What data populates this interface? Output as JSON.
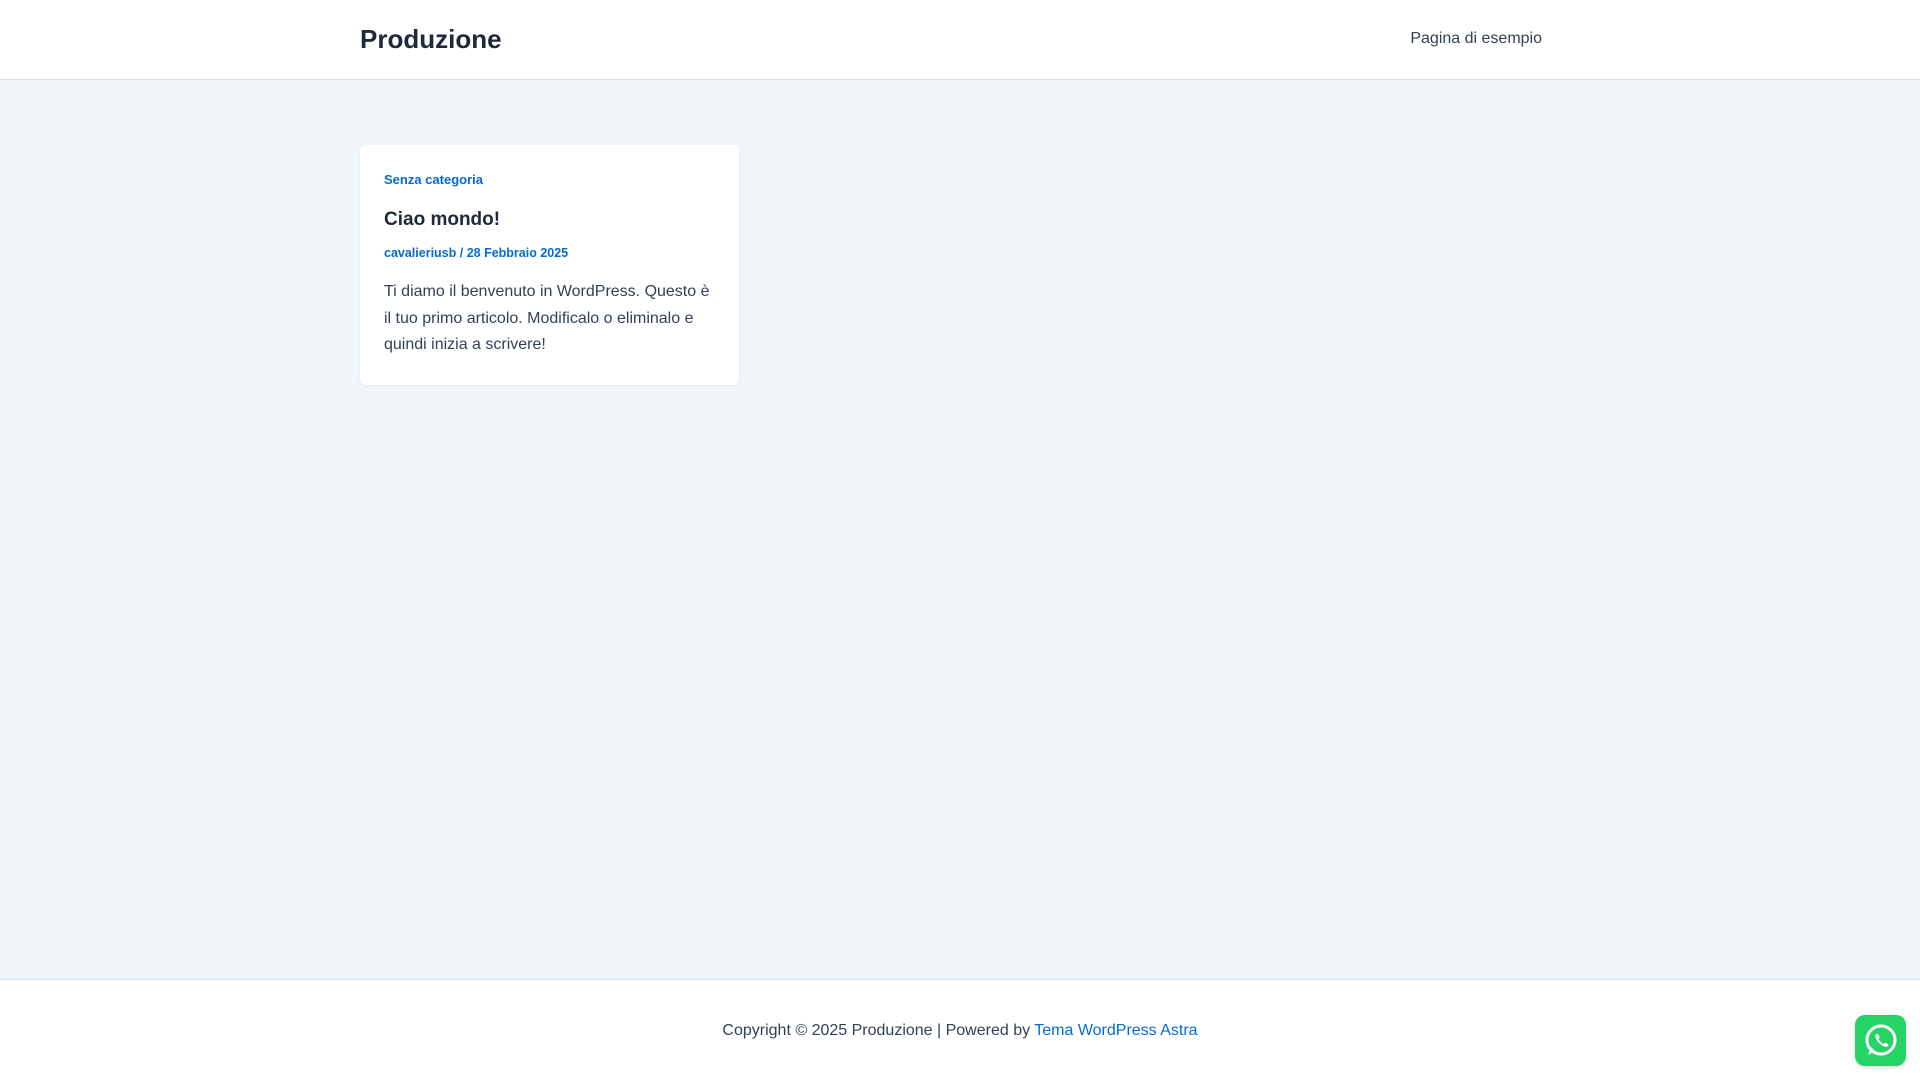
{
  "header": {
    "site_title": "Produzione",
    "nav": [
      {
        "label": "Pagina di esempio"
      }
    ]
  },
  "post": {
    "category": "Senza categoria",
    "title": "Ciao mondo!",
    "author": "cavalieriusb",
    "meta_separator": " / ",
    "date": "28 Febbraio 2025",
    "excerpt": "Ti diamo il benvenuto in WordPress. Questo è il tuo primo articolo. Modificalo o eliminalo e quindi inizia a scrivere!"
  },
  "footer": {
    "copyright": "Copyright © 2025 Produzione | Powered by ",
    "theme_link": "Tema WordPress Astra"
  },
  "floating": {
    "icon": "whatsapp-icon"
  },
  "colors": {
    "accent": "#046bd2",
    "background": "#f0f5fa",
    "whatsapp": "#25d366"
  }
}
